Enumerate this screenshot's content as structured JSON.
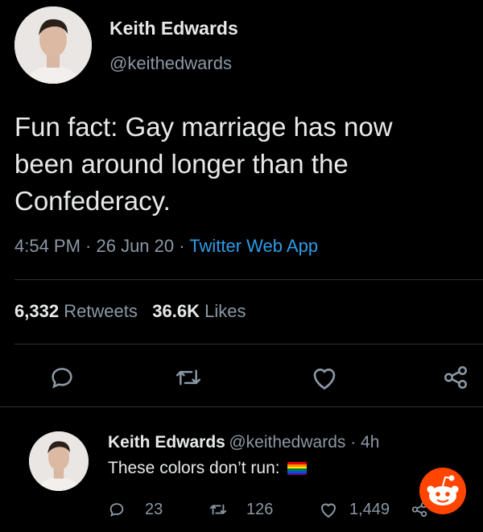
{
  "tweet": {
    "author_name": "Keith Edwards",
    "author_handle": "@keithedwards",
    "text_line1": "Fun fact: Gay marriage has now",
    "text_line2": "been around longer than the",
    "text_line3": "Confederacy.",
    "time": "4:54 PM · 26 Jun 20 · ",
    "source": "Twitter Web App",
    "retweets_count": "6,332",
    "retweets_label": "Retweets",
    "likes_count": "36.6K",
    "likes_label": "Likes"
  },
  "reply": {
    "author_name": "Keith Edwards",
    "author_handle": "@keithedwards · 4h",
    "text": "These colors don’t run:",
    "replies": "23",
    "retweets": "126",
    "likes": "1,449"
  },
  "flag_colors": [
    "#e40303",
    "#ff8c00",
    "#ffed00",
    "#008026",
    "#004dff",
    "#750787"
  ],
  "icons": [
    "reply-icon",
    "retweet-icon",
    "like-icon",
    "share-icon",
    "reddit-logo-icon"
  ]
}
